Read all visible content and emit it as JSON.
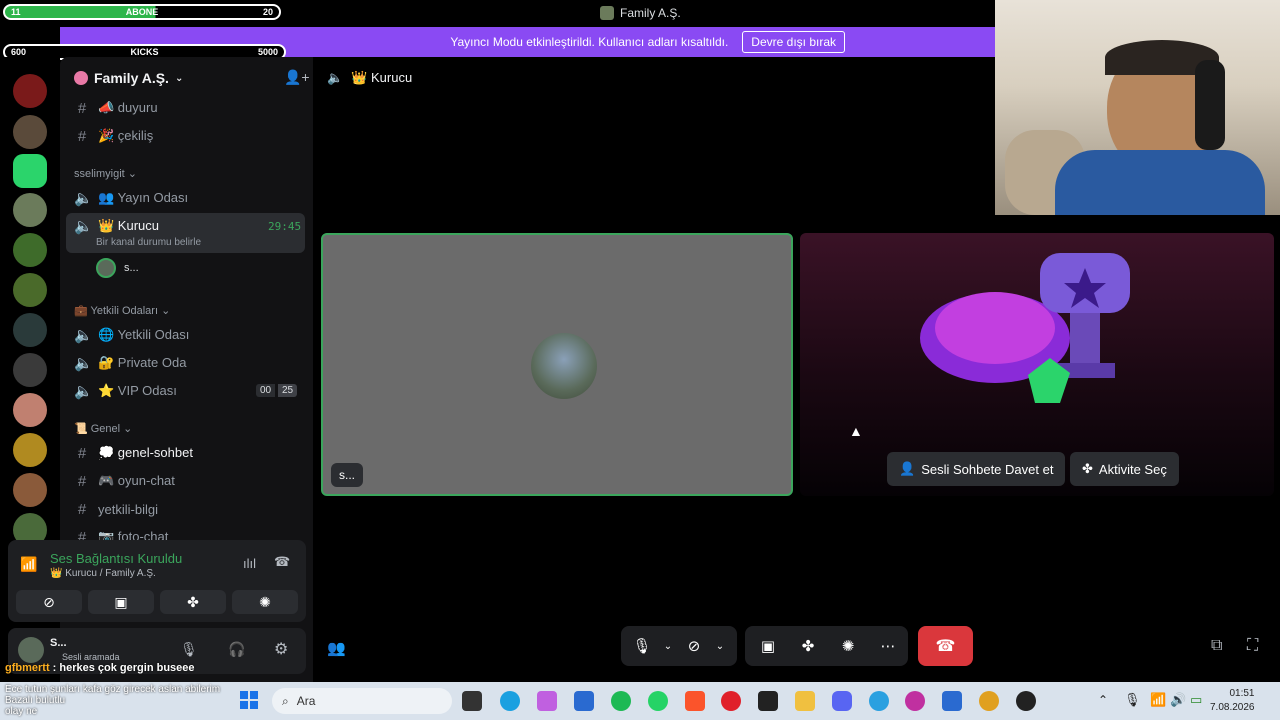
{
  "window": {
    "title": "Family A.Ş."
  },
  "overlay": {
    "bar1": {
      "left": "11",
      "mid": "ABONE",
      "right": "20",
      "progress": 0.55
    },
    "bar2": {
      "left": "600",
      "mid": "KICKS",
      "right": "5000"
    }
  },
  "banner": {
    "text": "Yayıncı Modu etkinleştirildi. Kullanıcı adları kısaltıldı.",
    "button": "Devre dışı bırak"
  },
  "guild": {
    "name": "Family A.Ş."
  },
  "channels": {
    "duyuru": "📣 duyuru",
    "cekilis": "🎉 çekiliş",
    "cat1": "sselimyigit",
    "yayin": "👥 Yayın Odası",
    "kurucu": "👑 Kurucu",
    "kurucu_time": "29:45",
    "kurucu_status": "Bir kanal durumu belirle",
    "member": "s...",
    "cat2": "💼 Yetkili Odaları",
    "yetkili": "🌐 Yetkili Odası",
    "private": "🔐 Private Oda",
    "vip": "⭐ VIP Odası",
    "vip_a": "00",
    "vip_b": "25",
    "cat3": "📜 Genel",
    "genel": "💭 genel-sohbet",
    "oyun": "🎮 oyun-chat",
    "bilgi": "yetkili-bilgi",
    "foto": "📷 foto-chat"
  },
  "voice": {
    "status": "Ses Bağlantısı Kuruldu",
    "channel": "👑 Kurucu / Family A.Ş."
  },
  "user": {
    "name": "S...",
    "status": "Sesli aramada"
  },
  "main": {
    "channel": "👑 Kurucu",
    "tile_label": "s...",
    "invite": "Sesli Sohbete Davet et",
    "activity": "Aktivite Seç"
  },
  "chat": {
    "user": "gfbmertt",
    "message": "herkes çok gergin buseee",
    "line2": "Ece tutun şunları kafa göz girecek aslan abilerim",
    "line3": "Bazalı bulutlu",
    "line4": "olay ne"
  },
  "taskbar": {
    "search": "Ara",
    "time": "01:51",
    "date": "7.08.2026"
  },
  "colors": {
    "accent": "#8a4af3",
    "connected": "#3ba55c",
    "hangup": "#da373c"
  }
}
